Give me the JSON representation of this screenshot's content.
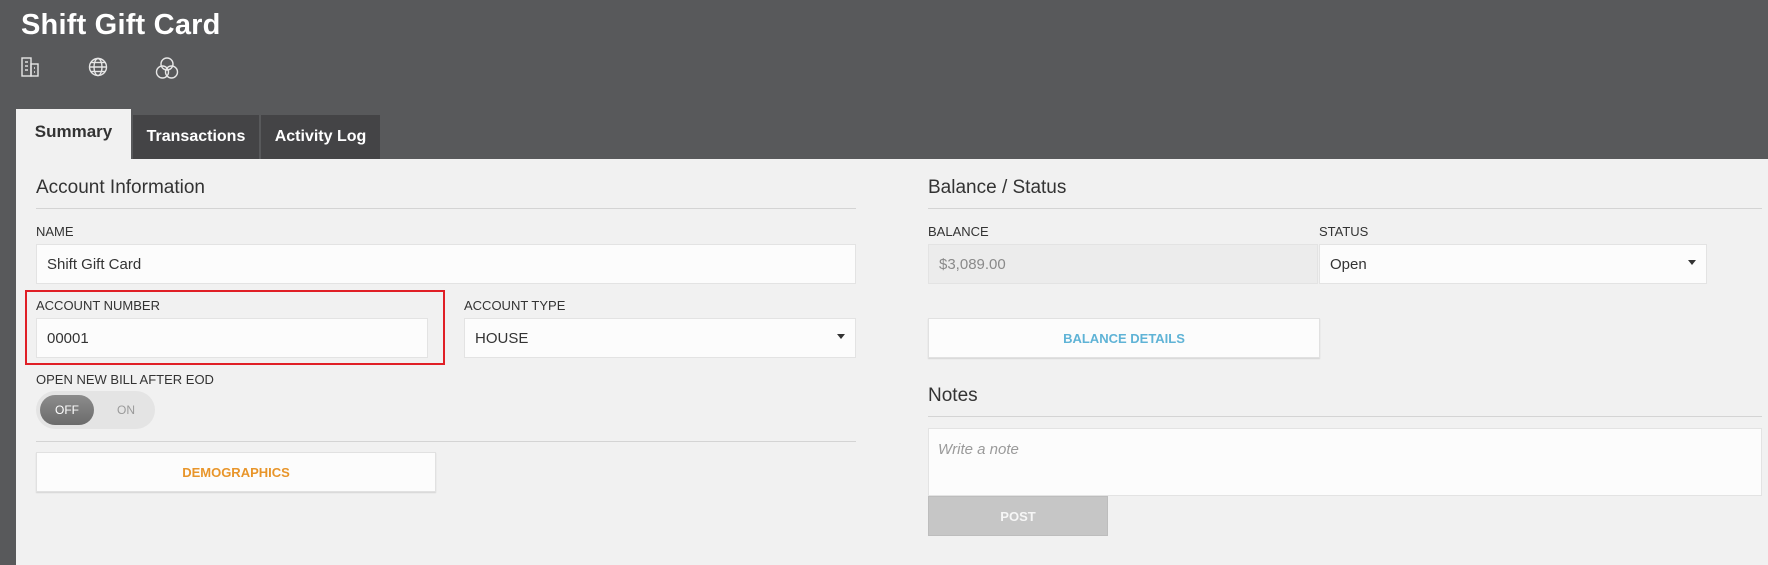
{
  "app": {
    "title": "Shift Gift Card"
  },
  "header_icons": [
    "building-icon",
    "globe-icon",
    "circles-icon"
  ],
  "tabs": [
    {
      "label": "Summary",
      "active": true
    },
    {
      "label": "Transactions",
      "active": false
    },
    {
      "label": "Activity Log",
      "active": false
    }
  ],
  "account": {
    "section_title": "Account Information",
    "name_label": "NAME",
    "name_value": "Shift Gift Card",
    "account_number_label": "ACCOUNT NUMBER",
    "account_number_value": "00001",
    "account_type_label": "ACCOUNT TYPE",
    "account_type_value": "HOUSE",
    "open_new_bill_label": "OPEN NEW BILL AFTER EOD",
    "toggle_off": "OFF",
    "toggle_on": "ON",
    "toggle_state": "OFF",
    "demographics_label": "DEMOGRAPHICS"
  },
  "balance": {
    "section_title": "Balance / Status",
    "balance_label": "BALANCE",
    "balance_value": "$3,089.00",
    "status_label": "STATUS",
    "status_value": "Open",
    "balance_details_label": "BALANCE DETAILS"
  },
  "notes": {
    "section_title": "Notes",
    "placeholder": "Write a note",
    "post_label": "POST"
  },
  "colors": {
    "header_bg": "#58595b",
    "panel_bg": "#f1f1f1",
    "demographics_text": "#e8952a",
    "balance_details_text": "#5fb3d6",
    "highlight_border": "#e01f26"
  }
}
